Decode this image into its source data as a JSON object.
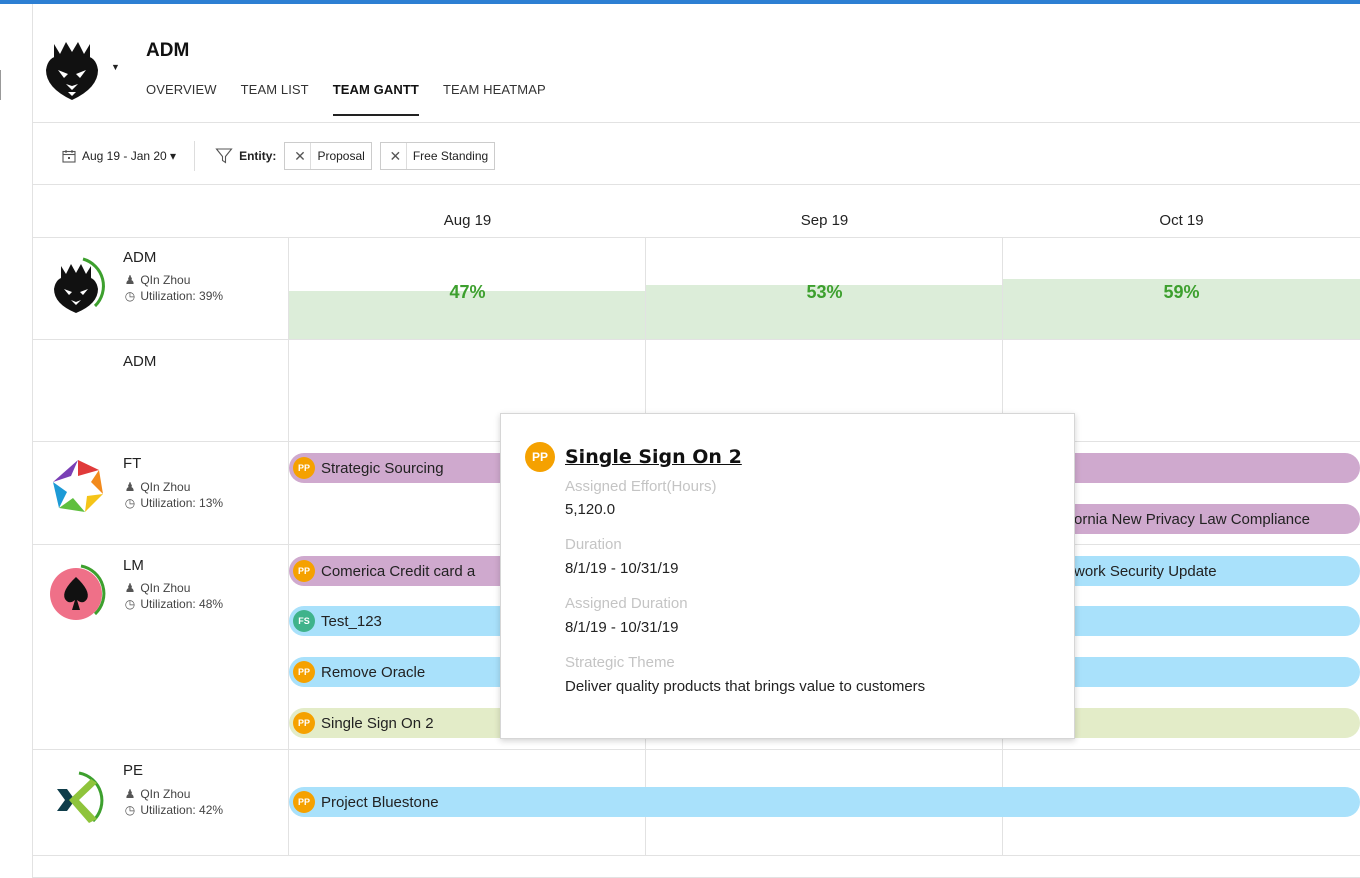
{
  "header": {
    "title": "ADM",
    "tabs": [
      {
        "label": "OVERVIEW"
      },
      {
        "label": "TEAM LIST"
      },
      {
        "label": "TEAM GANTT"
      },
      {
        "label": "TEAM HEATMAP"
      }
    ],
    "active_tab": "TEAM GANTT"
  },
  "filters": {
    "date_range": "Aug 19 - Jan 20 ▾",
    "entity_label": "Entity:",
    "chips": [
      "Proposal",
      "Free Standing"
    ]
  },
  "months": [
    "Aug 19",
    "Sep 19",
    "Oct 19"
  ],
  "resources": [
    {
      "name": "ADM",
      "owner": "QIn Zhou",
      "utilization": "Utilization: 39%",
      "monthly": [
        "47%",
        "53%",
        "59%"
      ],
      "monthly_values": [
        47,
        53,
        59
      ]
    },
    {
      "name": "ADM"
    },
    {
      "name": "FT",
      "owner": "QIn Zhou",
      "utilization": "Utilization: 13%"
    },
    {
      "name": "LM",
      "owner": "QIn Zhou",
      "utilization": "Utilization: 48%"
    },
    {
      "name": "PE",
      "owner": "QIn Zhou",
      "utilization": "Utilization: 42%"
    }
  ],
  "bars": {
    "ft_strategic": {
      "badge": "PP",
      "label": "Strategic Sourcing"
    },
    "ft_privacy": {
      "label": "ornia New Privacy Law Compliance"
    },
    "lm_comerica": {
      "badge": "PP",
      "label": "Comerica Credit card a"
    },
    "lm_network": {
      "label": "work Security Update"
    },
    "lm_test": {
      "badge": "FS",
      "label": "Test_123"
    },
    "lm_oracle": {
      "badge": "PP",
      "label": "Remove Oracle"
    },
    "lm_sso": {
      "badge": "PP",
      "label": "Single Sign On 2"
    },
    "pe_bluestone": {
      "badge": "PP",
      "label": "Project Bluestone"
    }
  },
  "tooltip": {
    "badge": "PP",
    "title": "Single Sign On 2",
    "fields": [
      {
        "label": "Assigned Effort(Hours)",
        "value": "5,120.0"
      },
      {
        "label": "Duration",
        "value": "8/1/19 - 10/31/19"
      },
      {
        "label": "Assigned Duration",
        "value": "8/1/19 - 10/31/19"
      },
      {
        "label": "Strategic Theme",
        "value": "Deliver quality products that brings value to customers"
      }
    ]
  },
  "colors": {
    "accent": "#2d7fd3",
    "utilization_fill": "#dcedd9",
    "utilization_text": "#3da02e",
    "proposal_badge": "#f5a100",
    "free_standing_badge": "#3fb38b",
    "bar_purple": "#cfa9ce",
    "bar_blue": "#a9e1fb",
    "bar_lime": "#e3ecc8"
  }
}
